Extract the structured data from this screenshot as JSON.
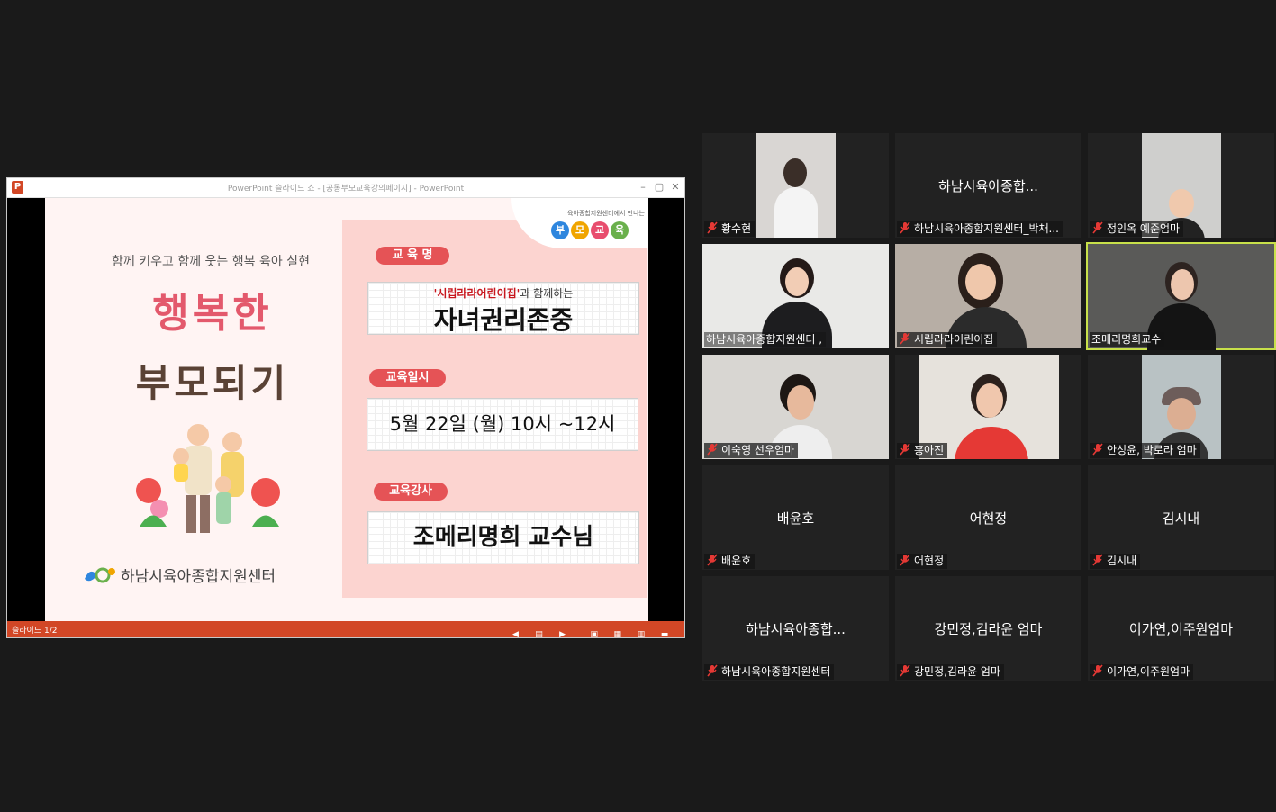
{
  "ppt": {
    "window_title": "PowerPoint 슬라이드 쇼 - [공동부모교육강의페이지] - PowerPoint",
    "logo_letter": "P",
    "status_left": "슬라이드 1/2",
    "slide": {
      "slogan": "함께 키우고 함께 웃는 행복 육아 실현",
      "title_line1": "행복한",
      "title_line2": "부모되기",
      "center_name": "하남시육아종합지원센터",
      "badge_sub": "육아종합지원센터에서 만나는",
      "badge_chars": [
        "부",
        "모",
        "교",
        "육"
      ],
      "badge_colors": [
        "#2e86de",
        "#f0a500",
        "#e84d6e",
        "#6ab04c"
      ],
      "label_name": "교 육 명",
      "program_sub_quote": "'시립라라어린이집'",
      "program_sub_rest": "과 함께하는",
      "program_title": "자녀권리존중",
      "label_date": "교육일시",
      "date_text": "5월 22일 (월) 10시 ~12시",
      "label_lecturer": "교육강사",
      "lecturer": "조메리명희 교수님"
    }
  },
  "participants": [
    {
      "label": "황수현",
      "center": "",
      "video": true,
      "active": false
    },
    {
      "label": "하남시육아종합지원센터_박채...",
      "center": "하남시육아종합...",
      "video": false,
      "active": false
    },
    {
      "label": "정인옥 예준엄마",
      "center": "",
      "video": true,
      "active": false
    },
    {
      "label": "하남시육아종합지원센터 ,",
      "center": "",
      "video": true,
      "active": false
    },
    {
      "label": "시립라라어린이집",
      "center": "",
      "video": true,
      "active": false
    },
    {
      "label": "조메리명희교수",
      "center": "",
      "video": true,
      "active": true
    },
    {
      "label": "이숙영 선우엄마",
      "center": "",
      "video": true,
      "active": false
    },
    {
      "label": "홍아진",
      "center": "",
      "video": true,
      "active": false
    },
    {
      "label": "안성윤, 박로라 엄마",
      "center": "",
      "video": true,
      "active": false
    },
    {
      "label": "배윤호",
      "center": "배윤호",
      "video": false,
      "active": false
    },
    {
      "label": "어현정",
      "center": "어현정",
      "video": false,
      "active": false
    },
    {
      "label": "김시내",
      "center": "김시내",
      "video": false,
      "active": false
    },
    {
      "label": "하남시육아종합지원센터",
      "center": "하남시육아종합...",
      "video": false,
      "active": false
    },
    {
      "label": "강민정,김라윤 엄마",
      "center": "강민정,김라윤 엄마",
      "video": false,
      "active": false
    },
    {
      "label": "이가연,이주원엄마",
      "center": "이가연,이주원엄마",
      "video": false,
      "active": false
    }
  ],
  "colors": {
    "accent_red": "#e55356",
    "status_bar": "#d24726",
    "active_speaker": "#c8e04a",
    "muted_icon": "#e53935"
  }
}
